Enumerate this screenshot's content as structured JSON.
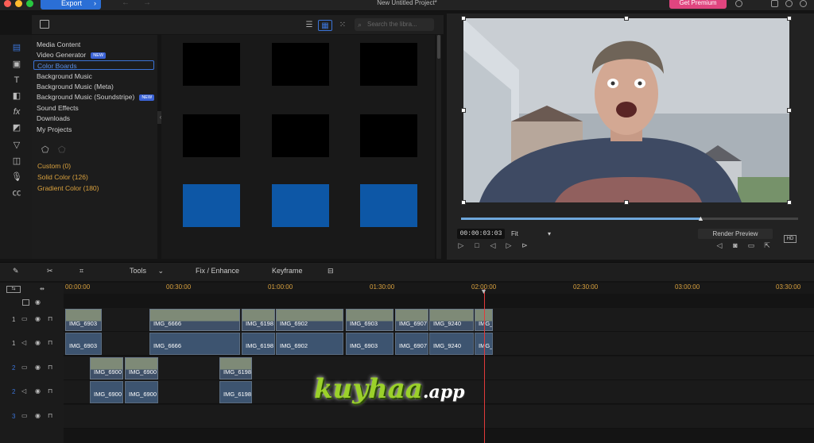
{
  "titlebar": {
    "export_label": "Export",
    "window_title": "New Untitled Project*",
    "premium_label": "Get Premium",
    "traffic_colors": [
      "#ff5f57",
      "#febc2e",
      "#28c840"
    ]
  },
  "library": {
    "search_placeholder": "Search the libra...",
    "categories": [
      {
        "label": "Media Content",
        "badge": ""
      },
      {
        "label": "Video Generator",
        "badge": "NEW"
      },
      {
        "label": "Color Boards",
        "badge": ""
      },
      {
        "label": "Background Music",
        "badge": ""
      },
      {
        "label": "Background Music (Meta)",
        "badge": ""
      },
      {
        "label": "Background Music (Soundstripe)",
        "badge": "NEW"
      },
      {
        "label": "Sound Effects",
        "badge": ""
      },
      {
        "label": "Downloads",
        "badge": ""
      },
      {
        "label": "My Projects",
        "badge": ""
      }
    ],
    "sub_items": [
      "Custom (0)",
      "Solid Color (126)",
      "Gradient Color (180)"
    ],
    "tile_colors": [
      "#000000",
      "#000000",
      "#000000",
      "#000000",
      "#000000",
      "#000000",
      "#0d57a6",
      "#0d57a6",
      "#0d57a6"
    ]
  },
  "preview": {
    "timecode": "00:00:03:03",
    "fit_label": "Fit",
    "render_label": "Render Preview",
    "progress": 0.71
  },
  "timeline_tools": {
    "tools_label": "Tools",
    "fix_label": "Fix / Enhance",
    "keyframe_label": "Keyframe"
  },
  "ruler": [
    "00:00:00",
    "00:30:00",
    "01:00:00",
    "01:30:00",
    "02:00:00",
    "02:30:00",
    "03:00:00",
    "03:30:00"
  ],
  "tracks": [
    {
      "num": "1",
      "kind": "video",
      "clips": [
        "IMG_6903",
        "IMG_6666",
        "IMG_6198",
        "IMG_6902",
        "IMG_6903",
        "IMG_6907",
        "IMG_9240",
        "IMG_"
      ]
    },
    {
      "num": "1",
      "kind": "audio",
      "clips": [
        "IMG_6903",
        "IMG_6666",
        "IMG_6198",
        "IMG_6902",
        "IMG_6903",
        "IMG_6907",
        "IMG_9240",
        "IMG_"
      ]
    },
    {
      "num": "2",
      "kind": "video",
      "clips": [
        "IMG_6900",
        "IMG_6900",
        "IMG_6198"
      ]
    },
    {
      "num": "2",
      "kind": "audio",
      "clips": [
        "IMG_6900",
        "IMG_6900",
        "IMG_6198"
      ]
    },
    {
      "num": "3",
      "kind": "video",
      "clips": []
    }
  ],
  "watermark": {
    "main": "kuyhaa",
    "suffix": ".app"
  }
}
